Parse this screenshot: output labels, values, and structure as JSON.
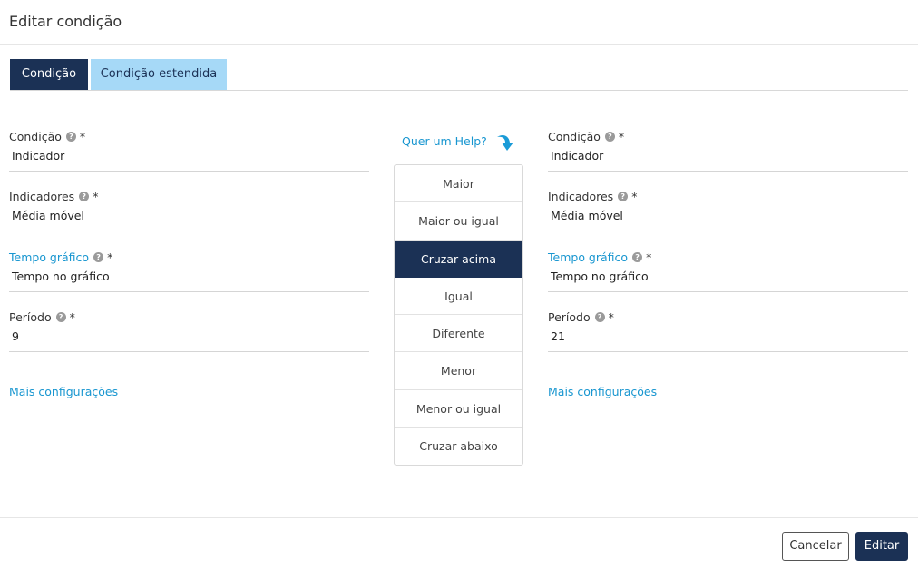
{
  "header": {
    "title": "Editar condição"
  },
  "tabs": [
    {
      "label": "Condição",
      "active": true
    },
    {
      "label": "Condição estendida",
      "active": false
    }
  ],
  "left": {
    "condicao": {
      "label": "Condição",
      "required": "*",
      "value": "Indicador"
    },
    "indicadores": {
      "label": "Indicadores",
      "required": "*",
      "value": "Média móvel"
    },
    "tempo": {
      "label": "Tempo gráfico",
      "required": "*",
      "value": "Tempo no gráfico"
    },
    "periodo": {
      "label": "Período",
      "required": "*",
      "value": "9"
    },
    "more": "Mais configurações"
  },
  "right": {
    "condicao": {
      "label": "Condição",
      "required": "*",
      "value": "Indicador"
    },
    "indicadores": {
      "label": "Indicadores",
      "required": "*",
      "value": "Média móvel"
    },
    "tempo": {
      "label": "Tempo gráfico",
      "required": "*",
      "value": "Tempo no gráfico"
    },
    "periodo": {
      "label": "Período",
      "required": "*",
      "value": "21"
    },
    "more": "Mais configurações"
  },
  "help": {
    "label": "Quer um Help?",
    "icon": "arrow-down-icon"
  },
  "operators": [
    {
      "label": "Maior",
      "selected": false
    },
    {
      "label": "Maior ou igual",
      "selected": false
    },
    {
      "label": "Cruzar acima",
      "selected": true
    },
    {
      "label": "Igual",
      "selected": false
    },
    {
      "label": "Diferente",
      "selected": false
    },
    {
      "label": "Menor",
      "selected": false
    },
    {
      "label": "Menor ou igual",
      "selected": false
    },
    {
      "label": "Cruzar abaixo",
      "selected": false
    }
  ],
  "footer": {
    "cancel": "Cancelar",
    "edit": "Editar"
  },
  "colors": {
    "primary": "#1b3155",
    "tab_inactive": "#a6d9f7",
    "link": "#1896d0"
  }
}
